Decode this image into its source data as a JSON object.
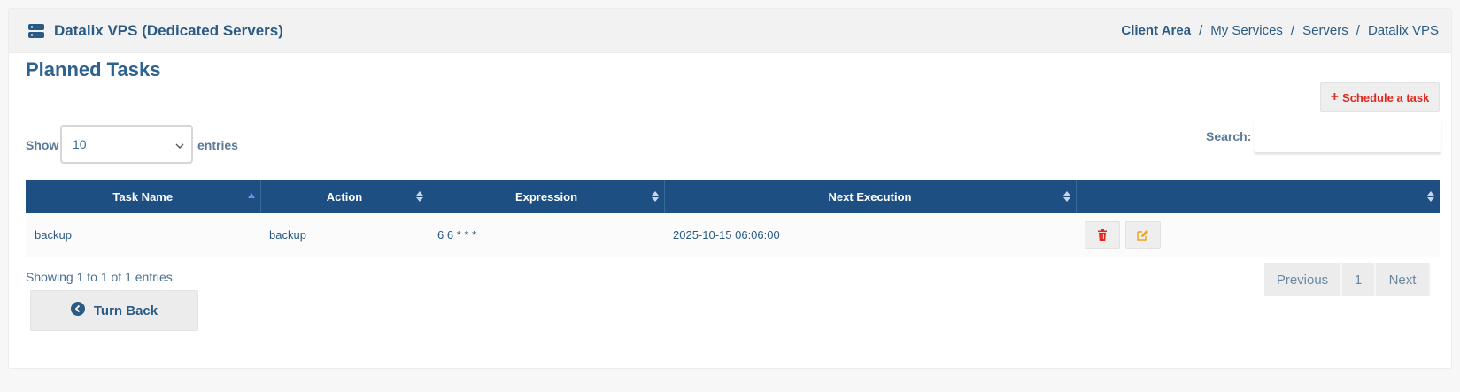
{
  "header": {
    "icon": "server-icon",
    "title": "Datalix VPS (Dedicated Servers)",
    "breadcrumb": [
      "Client Area",
      "My Services",
      "Servers",
      "Datalix VPS"
    ]
  },
  "page_title": "Planned Tasks",
  "schedule_button": {
    "label": "Schedule a task",
    "icon": "plus-icon",
    "color": "#e0281f"
  },
  "length_menu": {
    "show": "Show",
    "selected": "10",
    "entries": "entries"
  },
  "search": {
    "label": "Search:",
    "value": ""
  },
  "table": {
    "header_color": "#1d4f82",
    "columns": [
      "Task Name",
      "Action",
      "Expression",
      "Next Execution",
      ""
    ],
    "rows": [
      {
        "task_name": "backup",
        "action": "backup",
        "expression": "6 6 * * *",
        "next_execution": "2025-10-15 06:06:00"
      }
    ]
  },
  "info": "Showing 1 to 1 of 1 entries",
  "pagination": {
    "previous": "Previous",
    "page": "1",
    "next": "Next"
  },
  "turn_back": {
    "label": "Turn Back",
    "icon": "chevron-left-circle-icon"
  }
}
